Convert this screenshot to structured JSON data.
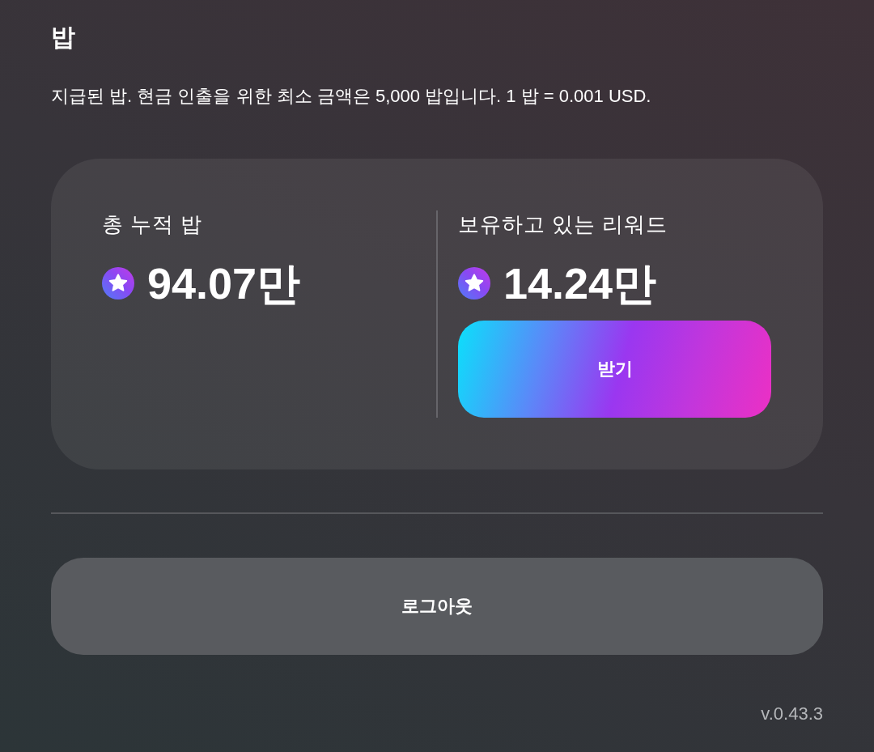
{
  "header": {
    "title": "밥",
    "description": "지급된 밥. 현금 인출을 위한 최소 금액은 5,000 밥입니다. 1 밥 = 0.001 USD."
  },
  "balance_card": {
    "stats": [
      {
        "label": "총 누적 밥",
        "value": "94.07만"
      },
      {
        "label": "보유하고 있는 리워드",
        "value": "14.24만",
        "button": "받기"
      }
    ]
  },
  "logout_button": "로그아웃",
  "version": "v.0.43.3"
}
